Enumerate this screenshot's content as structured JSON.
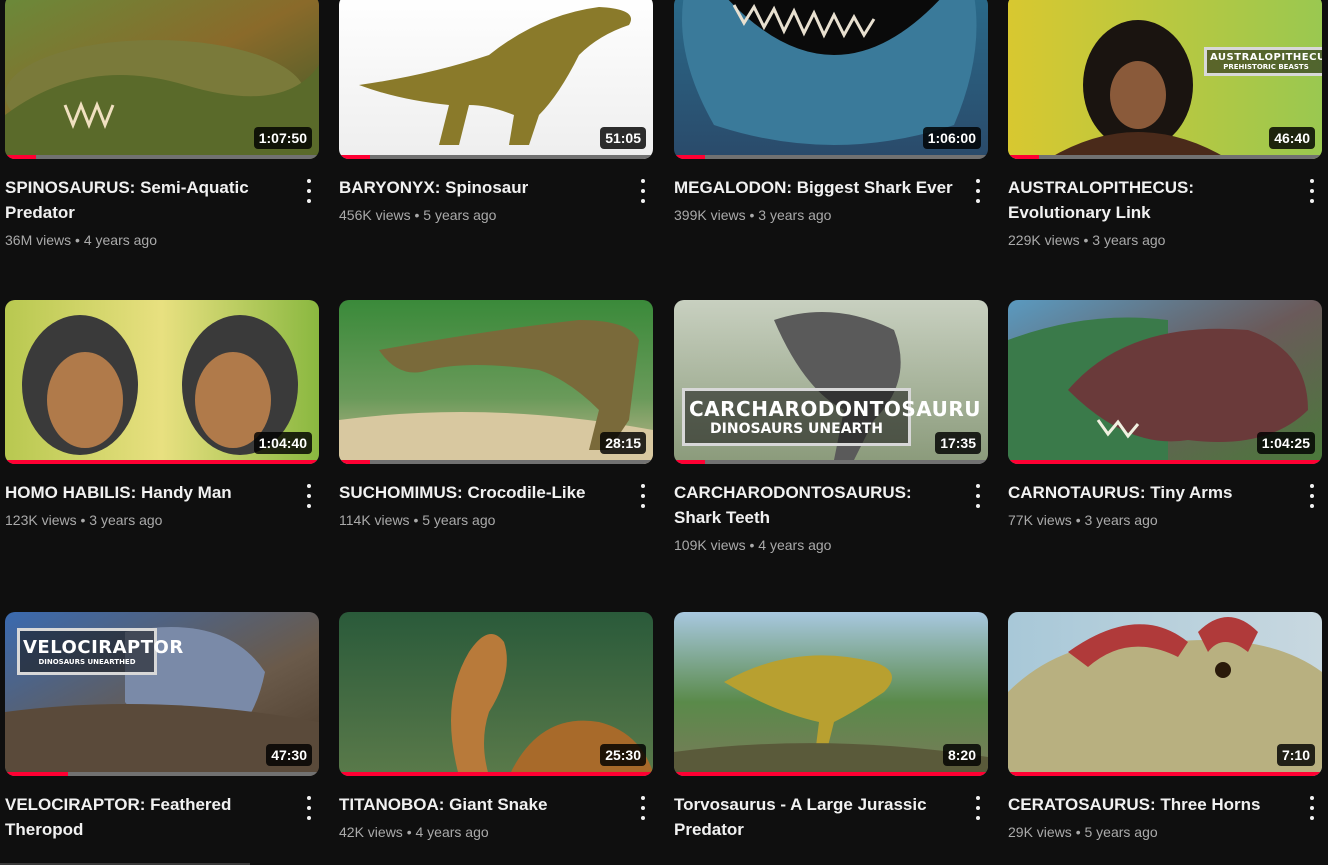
{
  "videos": [
    {
      "title": "SPINOSAURUS: Semi-Aquatic Predator",
      "views": "36M views",
      "age": "4 years ago",
      "duration": "1:07:50",
      "watched": 0.1
    },
    {
      "title": "BARYONYX: Spinosaur",
      "views": "456K views",
      "age": "5 years ago",
      "duration": "51:05",
      "watched": 0.1
    },
    {
      "title": "MEGALODON: Biggest Shark Ever",
      "views": "399K views",
      "age": "3 years ago",
      "duration": "1:06:00",
      "watched": 0.1
    },
    {
      "title": "AUSTRALOPITHECUS: Evolutionary Link",
      "views": "229K views",
      "age": "3 years ago",
      "duration": "46:40",
      "watched": 0.1,
      "overlay": {
        "big": "AUSTRALOPITHECUS",
        "small": "PREHISTORIC BEASTS"
      }
    },
    {
      "title": "HOMO HABILIS: Handy Man",
      "views": "123K views",
      "age": "3 years ago",
      "duration": "1:04:40",
      "watched": 1
    },
    {
      "title": "SUCHOMIMUS: Crocodile-Like",
      "views": "114K views",
      "age": "5 years ago",
      "duration": "28:15",
      "watched": 0.1
    },
    {
      "title": "CARCHARODONTOSAURUS: Shark Teeth",
      "views": "109K views",
      "age": "4 years ago",
      "duration": "17:35",
      "watched": 0.1,
      "overlay": {
        "big": "CARCHARODONTOSAURU",
        "small": "DINOSAURS UNEARTH"
      }
    },
    {
      "title": "CARNOTAURUS: Tiny Arms",
      "views": "77K views",
      "age": "3 years ago",
      "duration": "1:04:25",
      "watched": 1
    },
    {
      "title": "VELOCIRAPTOR: Feathered Theropod",
      "views": "",
      "age": "",
      "duration": "47:30",
      "watched": 0.2,
      "overlay": {
        "big": "VELOCIRAPTOR",
        "small": "DINOSAURS UNEARTHED"
      }
    },
    {
      "title": "TITANOBOA: Giant Snake",
      "views": "42K views",
      "age": "4 years ago",
      "duration": "25:30",
      "watched": 1
    },
    {
      "title": "Torvosaurus - A Large Jurassic Predator",
      "views": "",
      "age": "",
      "duration": "8:20",
      "watched": 1
    },
    {
      "title": "CERATOSAURUS: Three Horns",
      "views": "29K views",
      "age": "5 years ago",
      "duration": "7:10",
      "watched": 1
    }
  ],
  "colors": {
    "progress": "#ff0033",
    "background": "#0f0f0f"
  }
}
